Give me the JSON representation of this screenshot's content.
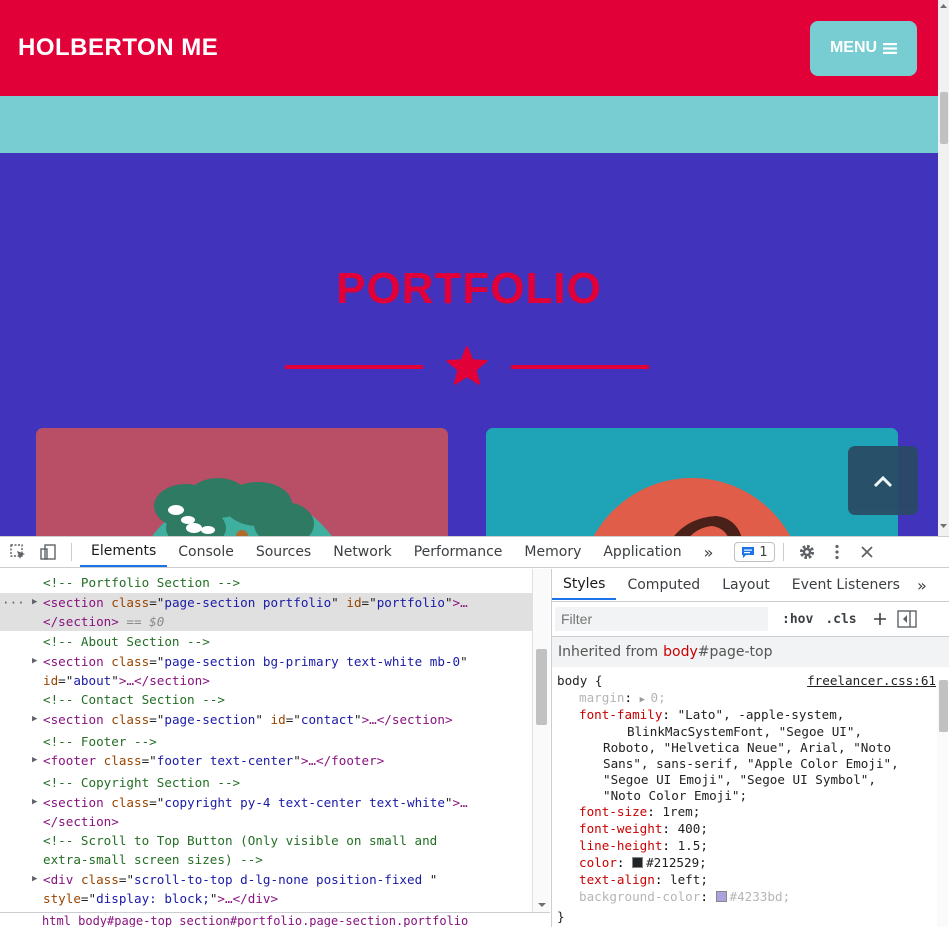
{
  "site": {
    "brand": "HOLBERTON ME",
    "menu_label": "MENU",
    "section_title": "PORTFOLIO",
    "colors": {
      "primary": "#e20038",
      "teal": "#77cdd1",
      "bg": "#4233bd",
      "card1": "#b84f66",
      "card2": "#1fa3b6"
    }
  },
  "devtools": {
    "tabs": [
      "Elements",
      "Console",
      "Sources",
      "Network",
      "Performance",
      "Memory",
      "Application"
    ],
    "more_tabs": "»",
    "issues_count": "1",
    "elements": [
      {
        "type": "comment",
        "text": "<!-- Portfolio Section -->"
      },
      {
        "type": "open",
        "tag": "section",
        "attrs": [
          [
            "class",
            "page-section portfolio"
          ],
          [
            "id",
            "portfolio"
          ]
        ],
        "tail": ">…"
      },
      {
        "type": "close",
        "text": "</section>",
        "suffix": " == $0"
      },
      {
        "type": "comment",
        "text": "<!-- About Section -->"
      },
      {
        "type": "open",
        "tag": "section",
        "attrs": [
          [
            "class",
            "page-section bg-primary text-white mb-0"
          ]
        ],
        "tail": ""
      },
      {
        "type": "cont",
        "attrs": [
          [
            "id",
            "about"
          ]
        ],
        "tail": ">…</section>"
      },
      {
        "type": "comment",
        "text": "<!-- Contact Section -->"
      },
      {
        "type": "open",
        "tag": "section",
        "attrs": [
          [
            "class",
            "page-section"
          ],
          [
            "id",
            "contact"
          ]
        ],
        "tail": ">…</section>"
      },
      {
        "type": "comment",
        "text": "<!-- Footer -->"
      },
      {
        "type": "open",
        "tag": "footer",
        "attrs": [
          [
            "class",
            "footer text-center"
          ]
        ],
        "tail": ">…</footer>"
      },
      {
        "type": "comment",
        "text": "<!-- Copyright Section -->"
      },
      {
        "type": "open",
        "tag": "section",
        "attrs": [
          [
            "class",
            "copyright py-4 text-center text-white"
          ]
        ],
        "tail": ">…"
      },
      {
        "type": "close",
        "text": "</section>",
        "suffix": ""
      },
      {
        "type": "comment",
        "text": "<!-- Scroll to Top Button (Only visible on small and"
      },
      {
        "type": "comment",
        "text": "extra-small screen sizes) -->"
      },
      {
        "type": "open",
        "tag": "div",
        "attrs": [
          [
            "class",
            "scroll-to-top d-lg-none position-fixed "
          ]
        ],
        "tail": ""
      },
      {
        "type": "cont",
        "attrs": [
          [
            "style",
            "display: block;"
          ]
        ],
        "tail": ">…</div>"
      }
    ],
    "breadcrumbs": "html  body#page-top  section#portfolio.page-section.portfolio",
    "styles_tabs": [
      "Styles",
      "Computed",
      "Layout",
      "Event Listeners"
    ],
    "filter_placeholder": "Filter",
    "hov": ":hov",
    "cls": ".cls",
    "inherited_label": "Inherited from",
    "inherited_selector_tag": "body",
    "inherited_selector_id": "#page-top",
    "rule_selector": "body {",
    "rule_source": "freelancer.css:61",
    "rule_close": "}",
    "properties": [
      {
        "name": "margin",
        "value": "0;",
        "dim": true,
        "arrow": true
      },
      {
        "name": "font-family",
        "value": "\"Lato\", -apple-system,",
        "cont": [
          "BlinkMacSystemFont, \"Segoe UI\",",
          "Roboto, \"Helvetica Neue\", Arial, \"Noto",
          "Sans\", sans-serif, \"Apple Color Emoji\",",
          "\"Segoe UI Emoji\", \"Segoe UI Symbol\",",
          "\"Noto Color Emoji\";"
        ]
      },
      {
        "name": "font-size",
        "value": "1rem;"
      },
      {
        "name": "font-weight",
        "value": "400;"
      },
      {
        "name": "line-height",
        "value": "1.5;"
      },
      {
        "name": "color",
        "value": "#212529;",
        "swatch": "#212529"
      },
      {
        "name": "text-align",
        "value": "left;"
      },
      {
        "name": "background-color",
        "value": "#4233bd;",
        "swatch": "#a9a3e0",
        "dim": true
      }
    ]
  }
}
